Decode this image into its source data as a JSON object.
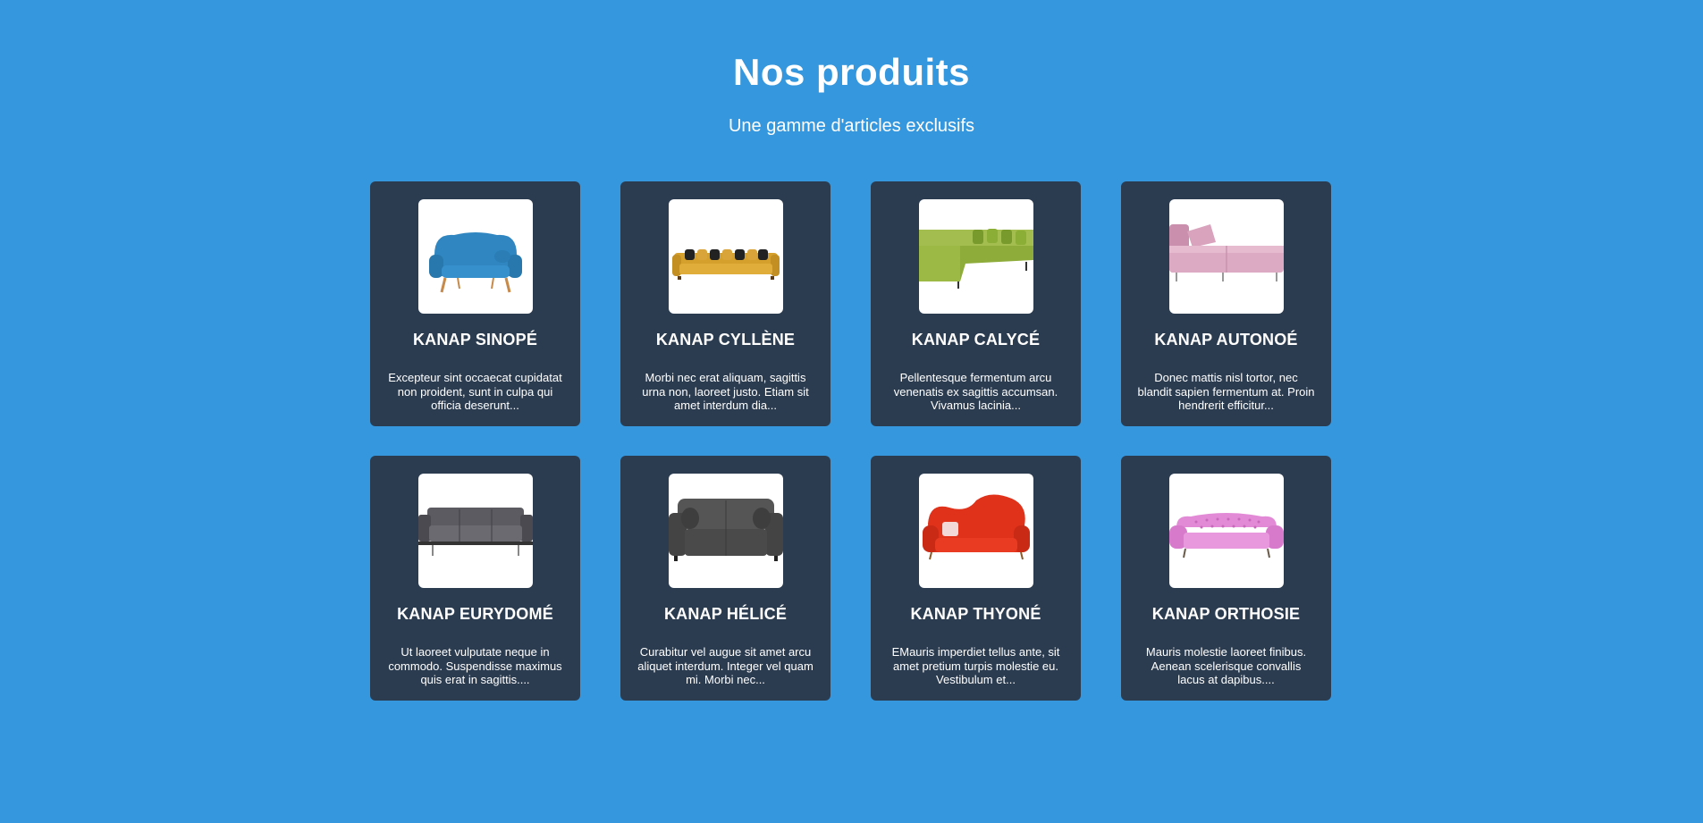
{
  "header": {
    "title": "Nos produits",
    "subtitle": "Une gamme d'articles exclusifs"
  },
  "products": [
    {
      "name": "KANAP SINOPÉ",
      "description": "Excepteur sint occaecat cupidatat non proident, sunt in culpa qui officia deserunt...",
      "image": "blue-sofa-image",
      "color": "#2f86c0"
    },
    {
      "name": "KANAP CYLLÈNE",
      "description": "Morbi nec erat aliquam, sagittis urna non, laoreet justo. Etiam sit amet interdum dia...",
      "image": "yellow-sofa-image",
      "color": "#d6a02c"
    },
    {
      "name": "KANAP CALYCÉ",
      "description": "Pellentesque fermentum arcu venenatis ex sagittis accumsan. Vivamus lacinia...",
      "image": "green-sofa-image",
      "color": "#8dac3a"
    },
    {
      "name": "KANAP AUTONOÉ",
      "description": "Donec mattis nisl tortor, nec blandit sapien fermentum at. Proin hendrerit efficitur...",
      "image": "pink-sofa-image",
      "color": "#d9a3bd"
    },
    {
      "name": "KANAP EURYDOMÉ",
      "description": "Ut laoreet vulputate neque in commodo. Suspendisse maximus quis erat in sagittis....",
      "image": "grey-sofa-image",
      "color": "#5b5b61"
    },
    {
      "name": "KANAP HÉLICÉ",
      "description": "Curabitur vel augue sit amet arcu aliquet interdum. Integer vel quam mi. Morbi nec...",
      "image": "dark-grey-sofa-image",
      "color": "#4a4a4a"
    },
    {
      "name": "KANAP THYONÉ",
      "description": "EMauris imperdiet tellus ante, sit amet pretium turpis molestie eu. Vestibulum et...",
      "image": "red-sofa-image",
      "color": "#e0321b"
    },
    {
      "name": "KANAP ORTHOSIE",
      "description": "Mauris molestie laoreet finibus. Aenean scelerisque convallis lacus at dapibus....",
      "image": "pink-tufted-sofa-image",
      "color": "#e28ad6"
    }
  ]
}
